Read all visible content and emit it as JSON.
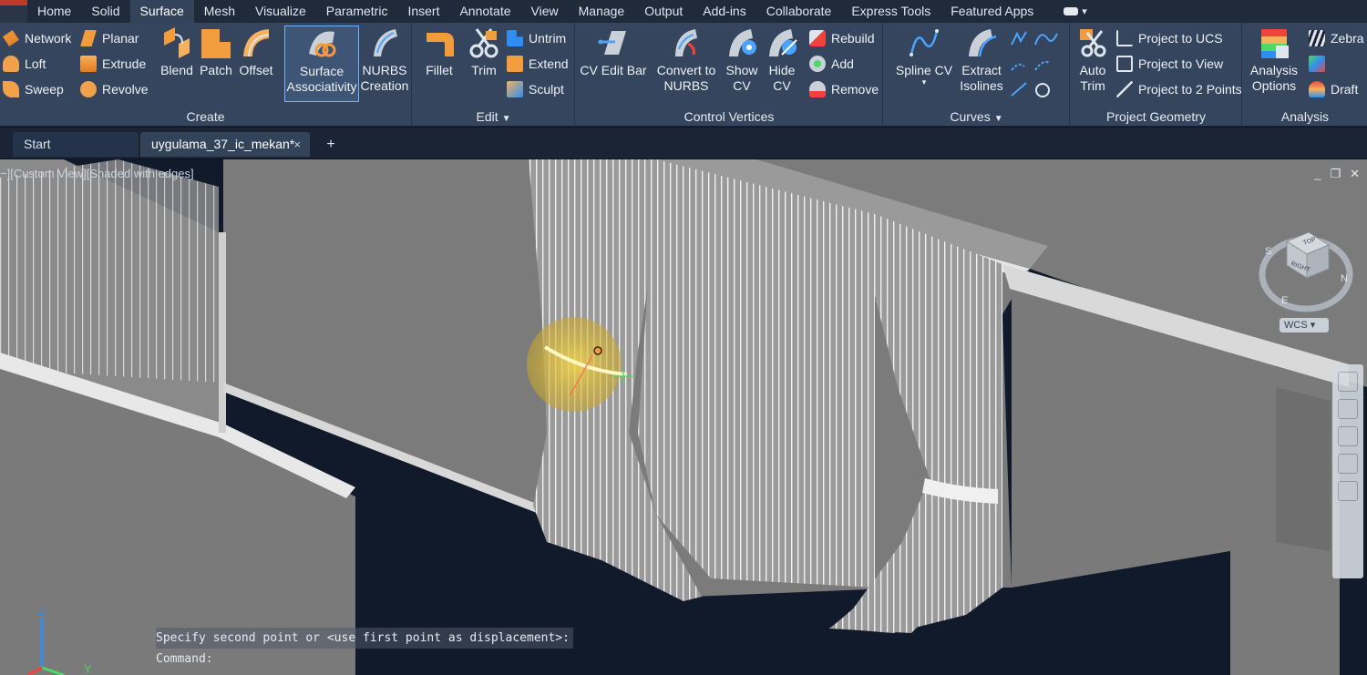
{
  "menu": {
    "tabs": [
      "Home",
      "Solid",
      "Surface",
      "Mesh",
      "Visualize",
      "Parametric",
      "Insert",
      "Annotate",
      "View",
      "Manage",
      "Output",
      "Add-ins",
      "Collaborate",
      "Express Tools",
      "Featured Apps"
    ],
    "active": "Surface"
  },
  "ribbon": {
    "create": {
      "title": "Create",
      "network": "Network",
      "loft": "Loft",
      "sweep": "Sweep",
      "planar": "Planar",
      "extrude": "Extrude",
      "revolve": "Revolve",
      "blend": "Blend",
      "patch": "Patch",
      "offset": "Offset",
      "surface_assoc_1": "Surface",
      "surface_assoc_2": "Associativity",
      "nurbs_1": "NURBS",
      "nurbs_2": "Creation"
    },
    "edit": {
      "title": "Edit",
      "fillet": "Fillet",
      "trim": "Trim",
      "untrim": "Untrim",
      "extend": "Extend",
      "sculpt": "Sculpt"
    },
    "cv": {
      "title": "Control Vertices",
      "cv_edit_bar": "CV Edit Bar",
      "convert_1": "Convert to",
      "convert_2": "NURBS",
      "show_1": "Show",
      "show_2": "CV",
      "hide_1": "Hide",
      "hide_2": "CV",
      "rebuild": "Rebuild",
      "add": "Add",
      "remove": "Remove"
    },
    "curves": {
      "title": "Curves",
      "spline_cv": "Spline CV",
      "extract_1": "Extract",
      "extract_2": "Isolines"
    },
    "project": {
      "title": "Project Geometry",
      "auto_1": "Auto",
      "auto_2": "Trim",
      "to_ucs": "Project to UCS",
      "to_view": "Project to View",
      "to_2pts": "Project to 2 Points"
    },
    "analysis": {
      "title": "Analysis",
      "options_1": "Analysis",
      "options_2": "Options",
      "zebra": "Zebra",
      "draft": "Draft"
    }
  },
  "file_tabs": {
    "start": "Start",
    "doc": "uygulama_37_ic_mekan*",
    "close": "×",
    "plus": "+"
  },
  "viewport": {
    "label": "−][Custom View][Shaded with edges]",
    "win_min": "_",
    "win_restore": "❐",
    "win_close": "✕",
    "wcs": "WCS",
    "viewcube_top": "TOP",
    "viewcube_right": "RIGHT",
    "compass_s": "S",
    "compass_n": "N",
    "compass_e": "E"
  },
  "command": {
    "history": "Specify second point or <use first point as displacement>:",
    "prompt": "Command:"
  },
  "ucs": {
    "x": "X",
    "y": "Y",
    "z": "Z"
  },
  "colors": {
    "ribbon_bg": "#34455d",
    "menubar_bg": "#1f2b3b",
    "viewport_bg": "#101a2a",
    "wall": "#7a7a7a",
    "highlight": "#f0d24a"
  }
}
